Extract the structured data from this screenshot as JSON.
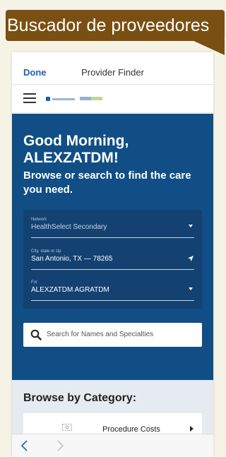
{
  "banner": {
    "text": "Buscador de proveedores"
  },
  "header": {
    "done_label": "Done",
    "title": "Provider Finder"
  },
  "hero": {
    "greeting": "Good Morning, ALEXZATDM!",
    "subtitle": "Browse or search to find the care you need."
  },
  "filters": {
    "network": {
      "label": "Network",
      "value": "HealthSelect Secondary"
    },
    "location": {
      "label": "City, state or zip",
      "value": "San Antonio, TX — 78265"
    },
    "for": {
      "label": "For",
      "value": "ALEXZATDM AGRATDM"
    }
  },
  "search": {
    "placeholder": "Search for Names and Specialties"
  },
  "browse": {
    "title": "Browse by Category:",
    "items": [
      {
        "label": "Procedure Costs",
        "icon": "procedure-costs-icon"
      }
    ]
  },
  "colors": {
    "banner": "#7a4f12",
    "hero": "#104e85",
    "filter_panel": "#134272",
    "link": "#1f5fb0",
    "browse_bg": "#e6ebf1"
  }
}
